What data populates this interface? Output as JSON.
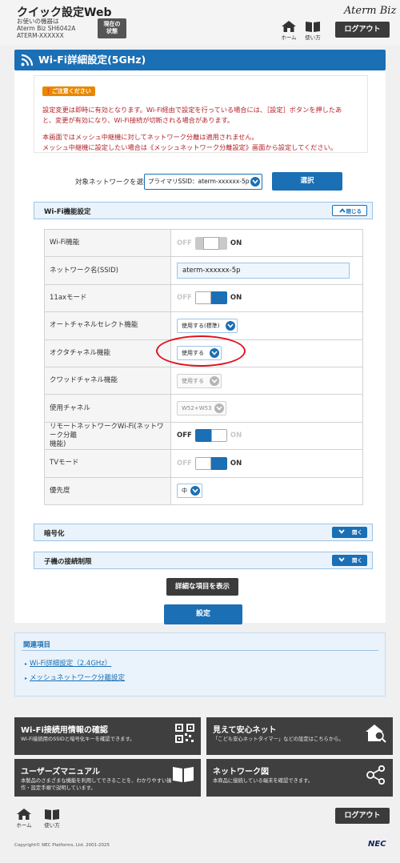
{
  "header": {
    "app_title": "クイック設定Web",
    "device_label": "お使いの機器は",
    "device_model": "Aterm Biz SH6042A",
    "device_name": "ATERM-XXXXXX",
    "status_button_line1": "現在の",
    "status_button_line2": "状態",
    "brand": "Aterm Biz",
    "home_label": "ホーム",
    "help_label": "使い方",
    "logout_label": "ログアウト"
  },
  "page": {
    "title": "Wi-Fi詳細設定(5GHz)"
  },
  "notice": {
    "badge": "ご注意ください",
    "line1": "設定変更は即時に有効となります。Wi-Fi経由で設定を行っている場合には、［設定］ボタンを押したあ",
    "line2": "と、変更が有効になり、Wi-Fi接続が切断される場合があります。",
    "line3": "本画面ではメッシュ中継機に対してネットワーク分離は適用されません。",
    "line4": "メッシュ中継機に設定したい場合は《メッシュネットワーク分離設定》画面から設定してください。"
  },
  "network_select": {
    "label": "対象ネットワークを選択",
    "value": "プライマリSSID：aterm-xxxxxx-5p",
    "button": "選択"
  },
  "wifi_section": {
    "title": "Wi-Fi機能設定",
    "close_label": "閉じる",
    "rows": {
      "wifi_function": {
        "label": "Wi-Fi機能",
        "off": "OFF",
        "on": "ON"
      },
      "ssid": {
        "label": "ネットワーク名(SSID)",
        "value": "aterm-xxxxxx-5p"
      },
      "ax_mode": {
        "label": "11axモード",
        "off": "OFF",
        "on": "ON"
      },
      "auto_channel": {
        "label": "オートチャネルセレクト機能",
        "value": "使用する(標準)"
      },
      "octa_channel": {
        "label": "オクタチャネル機能",
        "value": "使用する"
      },
      "quad_channel": {
        "label": "クワッドチャネル機能",
        "value": "使用する"
      },
      "channel": {
        "label": "使用チャネル",
        "value": "W52+W53"
      },
      "remote_network": {
        "label_line1": "リモートネットワークWi-Fi(ネットワーク分離",
        "label_line2": "機能)",
        "off": "OFF",
        "on": "ON"
      },
      "tv_mode": {
        "label": "TVモード",
        "off": "OFF",
        "on": "ON"
      },
      "priority": {
        "label": "優先度",
        "value": "中"
      }
    }
  },
  "encryption_section": {
    "title": "暗号化",
    "open_label": "開く"
  },
  "client_section": {
    "title": "子機の接続制限",
    "open_label": "開く"
  },
  "buttons": {
    "show_details": "詳細な項目を表示",
    "apply": "設定"
  },
  "related": {
    "title": "関連項目",
    "links": [
      "Wi-Fi詳細設定（2.4GHz）",
      "メッシュネットワーク分離設定"
    ]
  },
  "tiles": [
    {
      "title": "Wi-Fi接続用情報の確認",
      "desc": "Wi-Fi接続用のSSIDと暗号化キーを確認できます。",
      "icon": "qr-code-icon"
    },
    {
      "title": "見えて安心ネット",
      "desc": "「こども安心ネットタイマー」などの設定はこちらから。",
      "icon": "house-search-icon"
    },
    {
      "title": "ユーザーズマニュアル",
      "desc": "本製品のさまざまな機能を利用してできることを、わかりやすい操作・設定手順で説明しています。",
      "icon": "book-icon"
    },
    {
      "title": "ネットワーク図",
      "desc": "本商品に接続している端末を確認できます。",
      "icon": "network-graph-icon"
    }
  ],
  "footer": {
    "home_label": "ホーム",
    "help_label": "使い方",
    "logout_label": "ログアウト",
    "copyright": "Copyright© NEC Platforms, Ltd. 2001-2025",
    "nec_logo": "NEC"
  },
  "colors": {
    "accent": "#1a6fb5",
    "warning_text": "#b3222a",
    "badge": "#e98800",
    "highlight_circle": "#e0141c"
  }
}
